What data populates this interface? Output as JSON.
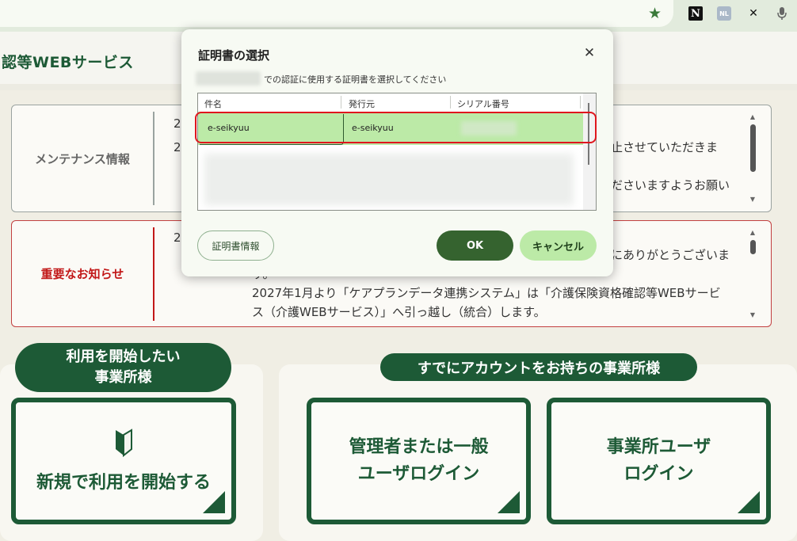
{
  "browser": {
    "extensions": [
      "N",
      "NL",
      "✕"
    ]
  },
  "page": {
    "title": "認等WEBサービス",
    "maintenance": {
      "label": "メンテナンス情報",
      "lines": [
        "2",
        "2",
        "止させていただきま",
        "ださいますようお願い"
      ]
    },
    "news": {
      "label": "重要なお知らせ",
      "line1_prefix": "2",
      "line1_suffix": "にありがとうございま",
      "line2": "す。",
      "line3": "2027年1月より「ケアプランデータ連携システム」は「介護保険資格確認等WEBサービ",
      "line4": "ス（介護WEBサービス）」へ引っ越し（統合）します。"
    },
    "start_pill": "利用を開始したい\n事業所様",
    "account_pill": "すでにアカウントをお持ちの事業所様",
    "card_new": "新規で利用を開始する",
    "card_admin_line1": "管理者または一般",
    "card_admin_line2": "ユーザログイン",
    "card_user_line1": "事業所ユーザ",
    "card_user_line2": "ログイン"
  },
  "dialog": {
    "title": "証明書の選択",
    "subtitle": "での認証に使用する証明書を選択してください",
    "columns": [
      "件名",
      "発行元",
      "シリアル番号"
    ],
    "rows": [
      {
        "subject": "e-seikyuu",
        "issuer": "e-seikyuu",
        "serial": ""
      }
    ],
    "buttons": {
      "info": "証明書情報",
      "ok": "OK",
      "cancel": "キャンセル"
    }
  },
  "colors": {
    "brand_green": "#1d5a36",
    "selected_row": "#bceaa7",
    "highlight_red": "#e0161e"
  }
}
